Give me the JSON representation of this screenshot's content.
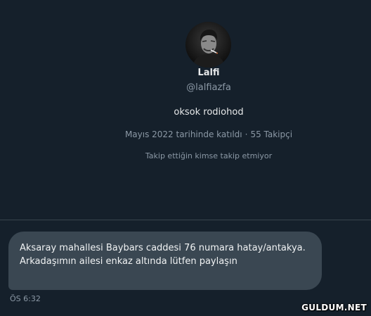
{
  "profile": {
    "avatar_icon": "profile-photo",
    "name": "Lalfi",
    "handle": "@lalfiazfa",
    "bio": "oksok rodiohod",
    "joined": "Mayıs 2022 tarihinde katıldı",
    "separator": "·",
    "followers": "55 Takipçi",
    "mutual_note": "Takip ettiğin kimse takip etmiyor"
  },
  "message": {
    "text": "Aksaray mahallesi Baybars caddesi 76 numara hatay/antakya. Arkadaşımın ailesi enkaz altında lütfen paylaşın",
    "time": "ÖS 6:32"
  },
  "watermark": "GULDUM.NET",
  "colors": {
    "background": "#15202b",
    "bubble": "#3a4752",
    "secondary_text": "#8b98a5",
    "divider": "#38444d"
  }
}
